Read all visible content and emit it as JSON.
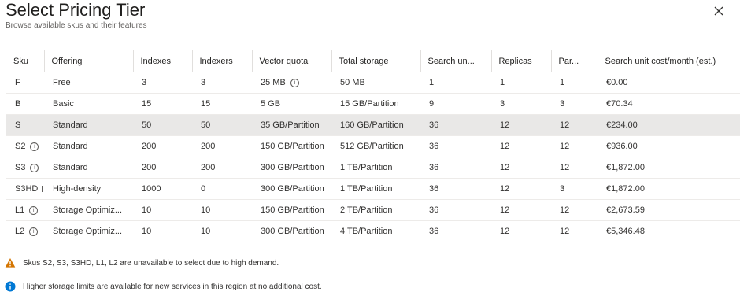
{
  "dialog": {
    "title": "Select Pricing Tier",
    "subtitle": "Browse available skus and their features"
  },
  "table": {
    "columns": [
      "Sku",
      "Offering",
      "Indexes",
      "Indexers",
      "Vector quota",
      "Total storage",
      "Search un...",
      "Replicas",
      "Par...",
      "Search unit cost/month (est.)"
    ],
    "rows": [
      {
        "sku": "F",
        "sku_info": "",
        "offering": "Free",
        "indexes": "3",
        "indexers": "3",
        "vector": "25 MB",
        "vector_info": true,
        "storage": "50 MB",
        "search_units": "1",
        "replicas": "1",
        "partitions": "1",
        "cost": "€0.00",
        "selected": false
      },
      {
        "sku": "B",
        "sku_info": "",
        "offering": "Basic",
        "indexes": "15",
        "indexers": "15",
        "vector": "5 GB",
        "vector_info": false,
        "storage": "15 GB/Partition",
        "search_units": "9",
        "replicas": "3",
        "partitions": "3",
        "cost": "€70.34",
        "selected": false
      },
      {
        "sku": "S",
        "sku_info": "",
        "offering": "Standard",
        "indexes": "50",
        "indexers": "50",
        "vector": "35 GB/Partition",
        "vector_info": false,
        "storage": "160 GB/Partition",
        "search_units": "36",
        "replicas": "12",
        "partitions": "12",
        "cost": "€234.00",
        "selected": true
      },
      {
        "sku": "S2",
        "sku_info": "info",
        "offering": "Standard",
        "indexes": "200",
        "indexers": "200",
        "vector": "150 GB/Partition",
        "vector_info": false,
        "storage": "512 GB/Partition",
        "search_units": "36",
        "replicas": "12",
        "partitions": "12",
        "cost": "€936.00",
        "selected": false
      },
      {
        "sku": "S3",
        "sku_info": "info",
        "offering": "Standard",
        "indexes": "200",
        "indexers": "200",
        "vector": "300 GB/Partition",
        "vector_info": false,
        "storage": "1 TB/Partition",
        "search_units": "36",
        "replicas": "12",
        "partitions": "12",
        "cost": "€1,872.00",
        "selected": false
      },
      {
        "sku": "S3HD",
        "sku_info": "tick",
        "offering": "High-density",
        "indexes": "1000",
        "indexers": "0",
        "vector": "300 GB/Partition",
        "vector_info": false,
        "storage": "1 TB/Partition",
        "search_units": "36",
        "replicas": "12",
        "partitions": "3",
        "cost": "€1,872.00",
        "selected": false
      },
      {
        "sku": "L1",
        "sku_info": "info",
        "offering": "Storage Optimiz...",
        "indexes": "10",
        "indexers": "10",
        "vector": "150 GB/Partition",
        "vector_info": false,
        "storage": "2 TB/Partition",
        "search_units": "36",
        "replicas": "12",
        "partitions": "12",
        "cost": "€2,673.59",
        "selected": false
      },
      {
        "sku": "L2",
        "sku_info": "info",
        "offering": "Storage Optimiz...",
        "indexes": "10",
        "indexers": "10",
        "vector": "300 GB/Partition",
        "vector_info": false,
        "storage": "4 TB/Partition",
        "search_units": "36",
        "replicas": "12",
        "partitions": "12",
        "cost": "€5,346.48",
        "selected": false
      }
    ]
  },
  "notices": {
    "warning": "Skus S2, S3, S3HD, L1, L2 are unavailable to select due to high demand.",
    "info": "Higher storage limits are available for new services in this region at no additional cost."
  },
  "colors": {
    "warning": "#d47500",
    "info": "#0078d4",
    "selected_row": "#e9e8e7"
  }
}
